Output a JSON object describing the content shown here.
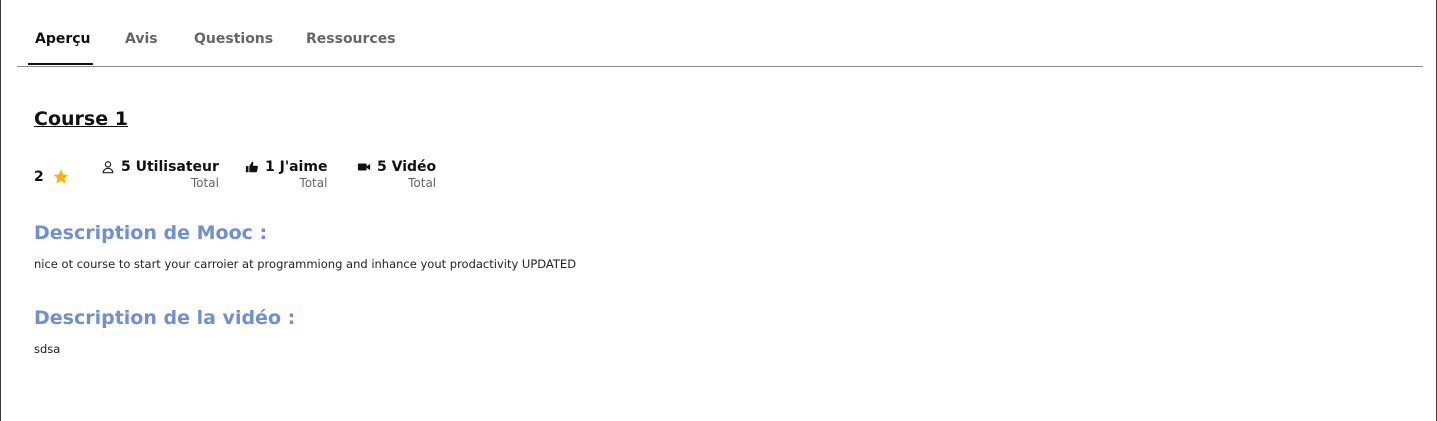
{
  "tabs": [
    {
      "label": "Aperçu",
      "active": true
    },
    {
      "label": "Avis",
      "active": false
    },
    {
      "label": "Questions",
      "active": false
    },
    {
      "label": "Ressources",
      "active": false
    }
  ],
  "course": {
    "title": "Course 1",
    "rating": "2",
    "stats": [
      {
        "value": "5 Utilisateur",
        "sub": "Total",
        "icon": "user-icon"
      },
      {
        "value": "1 J'aime",
        "sub": "Total",
        "icon": "thumbs-up-icon"
      },
      {
        "value": "5 Vidéo",
        "sub": "Total",
        "icon": "video-camera-icon"
      }
    ]
  },
  "sections": [
    {
      "heading": "Description de Mooc :",
      "text": "nice ot course to start your carroier at programmiong and inhance yout prodactivity UPDATED"
    },
    {
      "heading": "Description de la vidéo :",
      "text": "sdsa"
    }
  ],
  "colors": {
    "accent_heading": "#6f8fd6",
    "star": "#f5b50a",
    "tab_underline": "#111111"
  }
}
